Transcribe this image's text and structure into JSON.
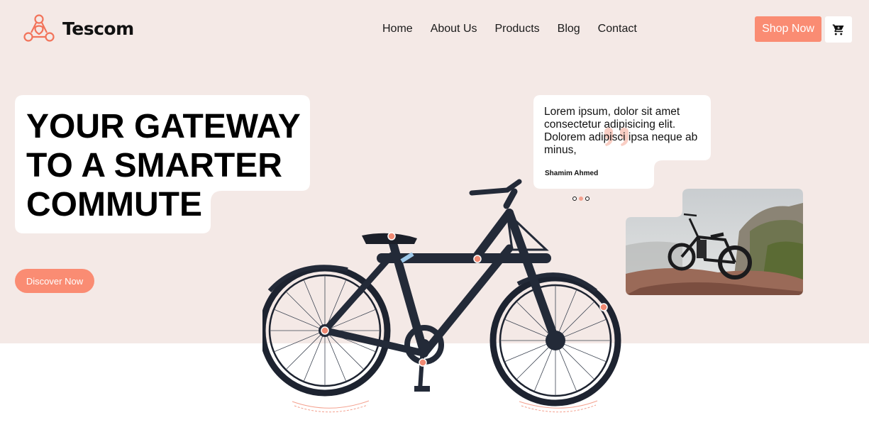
{
  "brand": {
    "name": "Tescom",
    "logo_icon": "hub-logo-icon"
  },
  "nav": {
    "items": [
      {
        "label": "Home"
      },
      {
        "label": "About Us"
      },
      {
        "label": "Products"
      },
      {
        "label": "Blog"
      },
      {
        "label": "Contact"
      }
    ]
  },
  "header": {
    "shop_label": "Shop Now",
    "cart_icon": "cart-icon"
  },
  "hero": {
    "headline": [
      "YOUR GATEWAY",
      "TO A SMARTER",
      "COMMUTE"
    ],
    "cta_label": "Discover Now"
  },
  "testimonial": {
    "text": "Lorem ipsum, dolor sit amet consectetur adipisicing elit. Dolorem adipisci ipsa neque ab minus,",
    "author": "Shamim Ahmed",
    "dots": 3,
    "active_dot": 1
  },
  "colors": {
    "accent": "#fa8c73",
    "hero_bg": "#f4e9e6",
    "bike": "#232a38"
  }
}
